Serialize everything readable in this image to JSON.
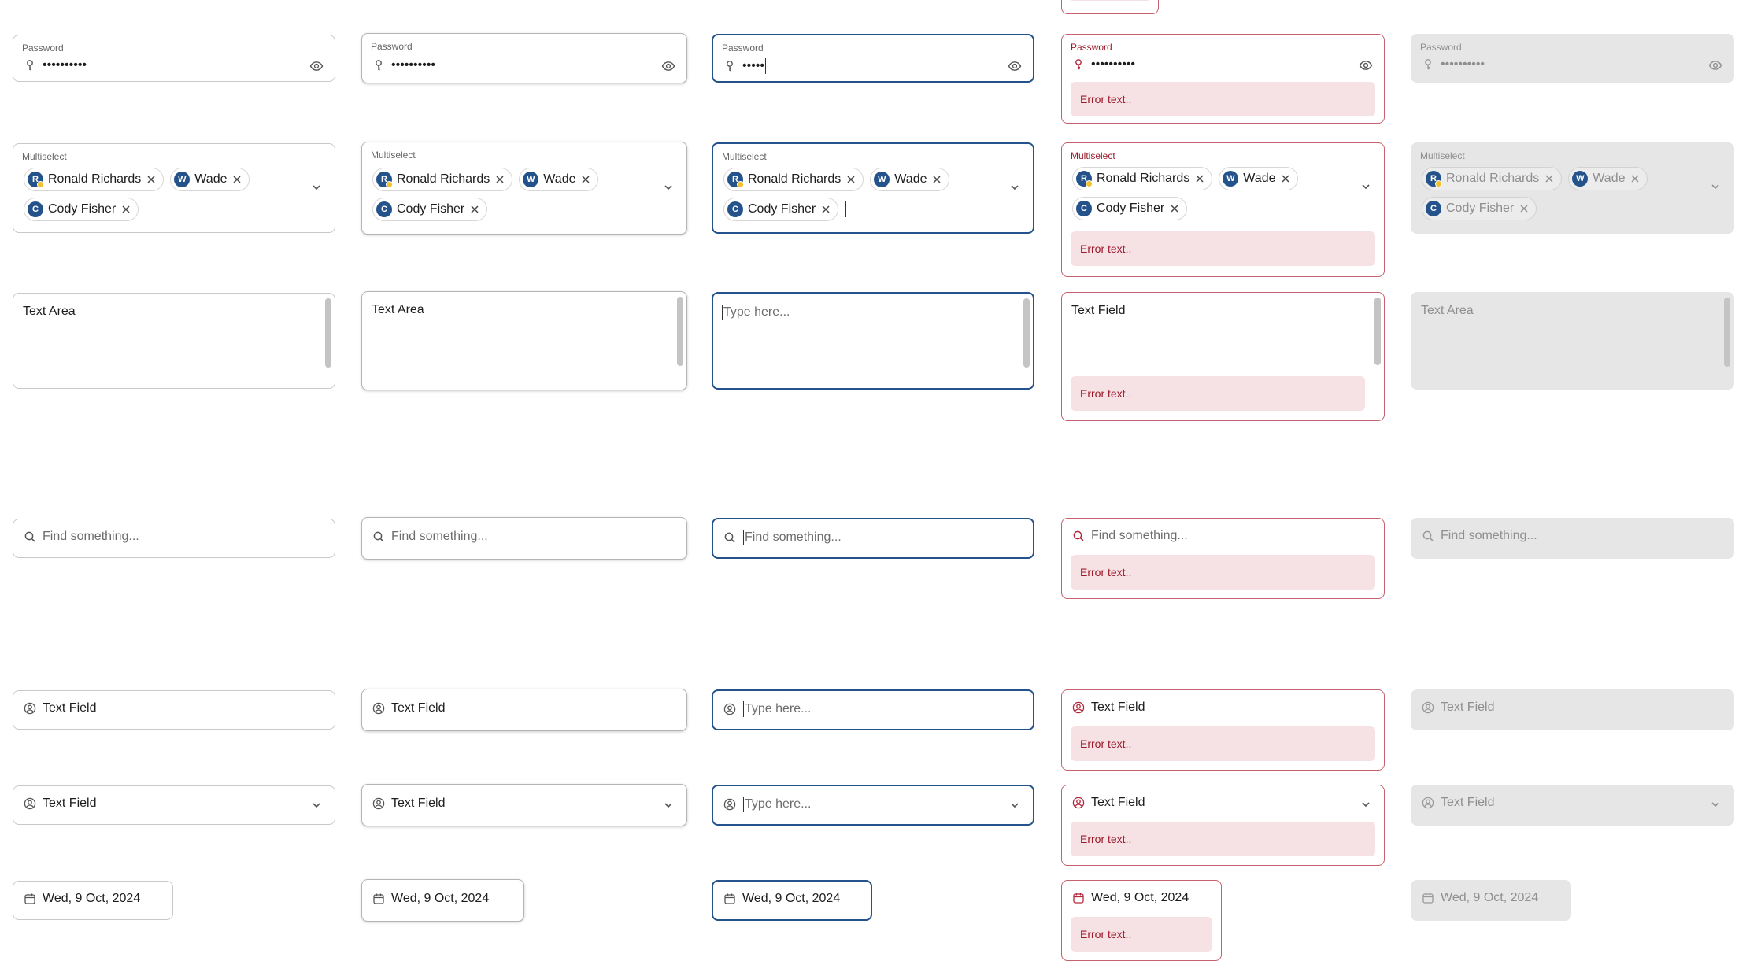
{
  "password": {
    "label": "Password",
    "masked_value": "••••••••••",
    "focused_value": "•••••",
    "error_text": "Error text.."
  },
  "multiselect": {
    "label": "Multiselect",
    "chips": [
      {
        "name": "Ronald Richards",
        "initial": "R",
        "badge": true
      },
      {
        "name": "Wade",
        "initial": "W",
        "badge": false
      },
      {
        "name": "Cody Fisher",
        "initial": "C",
        "badge": false
      }
    ],
    "error_text": "Error text.."
  },
  "textarea": {
    "value": "Text Area",
    "placeholder": "Type here...",
    "error_value": "Text Field",
    "error_text": "Error text.."
  },
  "search": {
    "placeholder": "Find something...",
    "error_text": "Error text.."
  },
  "text_field": {
    "value": "Text Field",
    "placeholder": "Type here...",
    "error_text": "Error text.."
  },
  "dropdown_field": {
    "value": "Text Field",
    "placeholder": "Type here...",
    "error_text": "Error text.."
  },
  "date_field": {
    "value": "Wed, 9 Oct, 2024",
    "error_text": "Error text.."
  },
  "icons": {
    "password": "key-icon",
    "reveal": "eye-icon",
    "dropdown": "chevron-down-icon",
    "remove_chip": "close-icon",
    "search": "search-icon",
    "user": "user-circle-icon",
    "date": "calendar-icon"
  },
  "colors": {
    "focus_border": "#24528a",
    "error_border": "#c6616f",
    "error_background": "#f6e1e4",
    "error_text": "#9b1b2b",
    "disabled_background": "#e6e6e6",
    "avatar": "#24528a"
  }
}
